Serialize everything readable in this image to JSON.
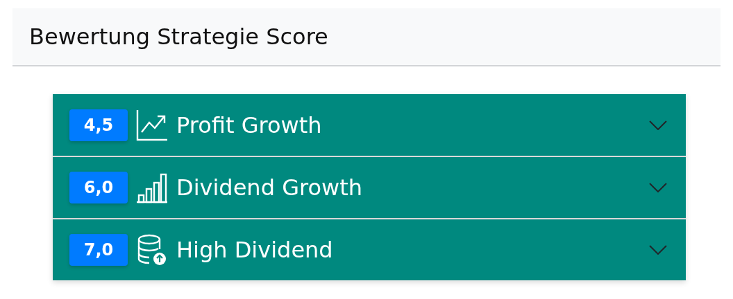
{
  "header": {
    "title": "Bewertung Strategie Score"
  },
  "accordion": [
    {
      "score": "4,5",
      "kind": "line-chart",
      "label": "Profit Growth",
      "expanded": false
    },
    {
      "score": "6,0",
      "kind": "bar-chart",
      "label": "Dividend Growth",
      "expanded": false
    },
    {
      "score": "7,0",
      "kind": "database",
      "label": "High Dividend",
      "expanded": false
    }
  ]
}
